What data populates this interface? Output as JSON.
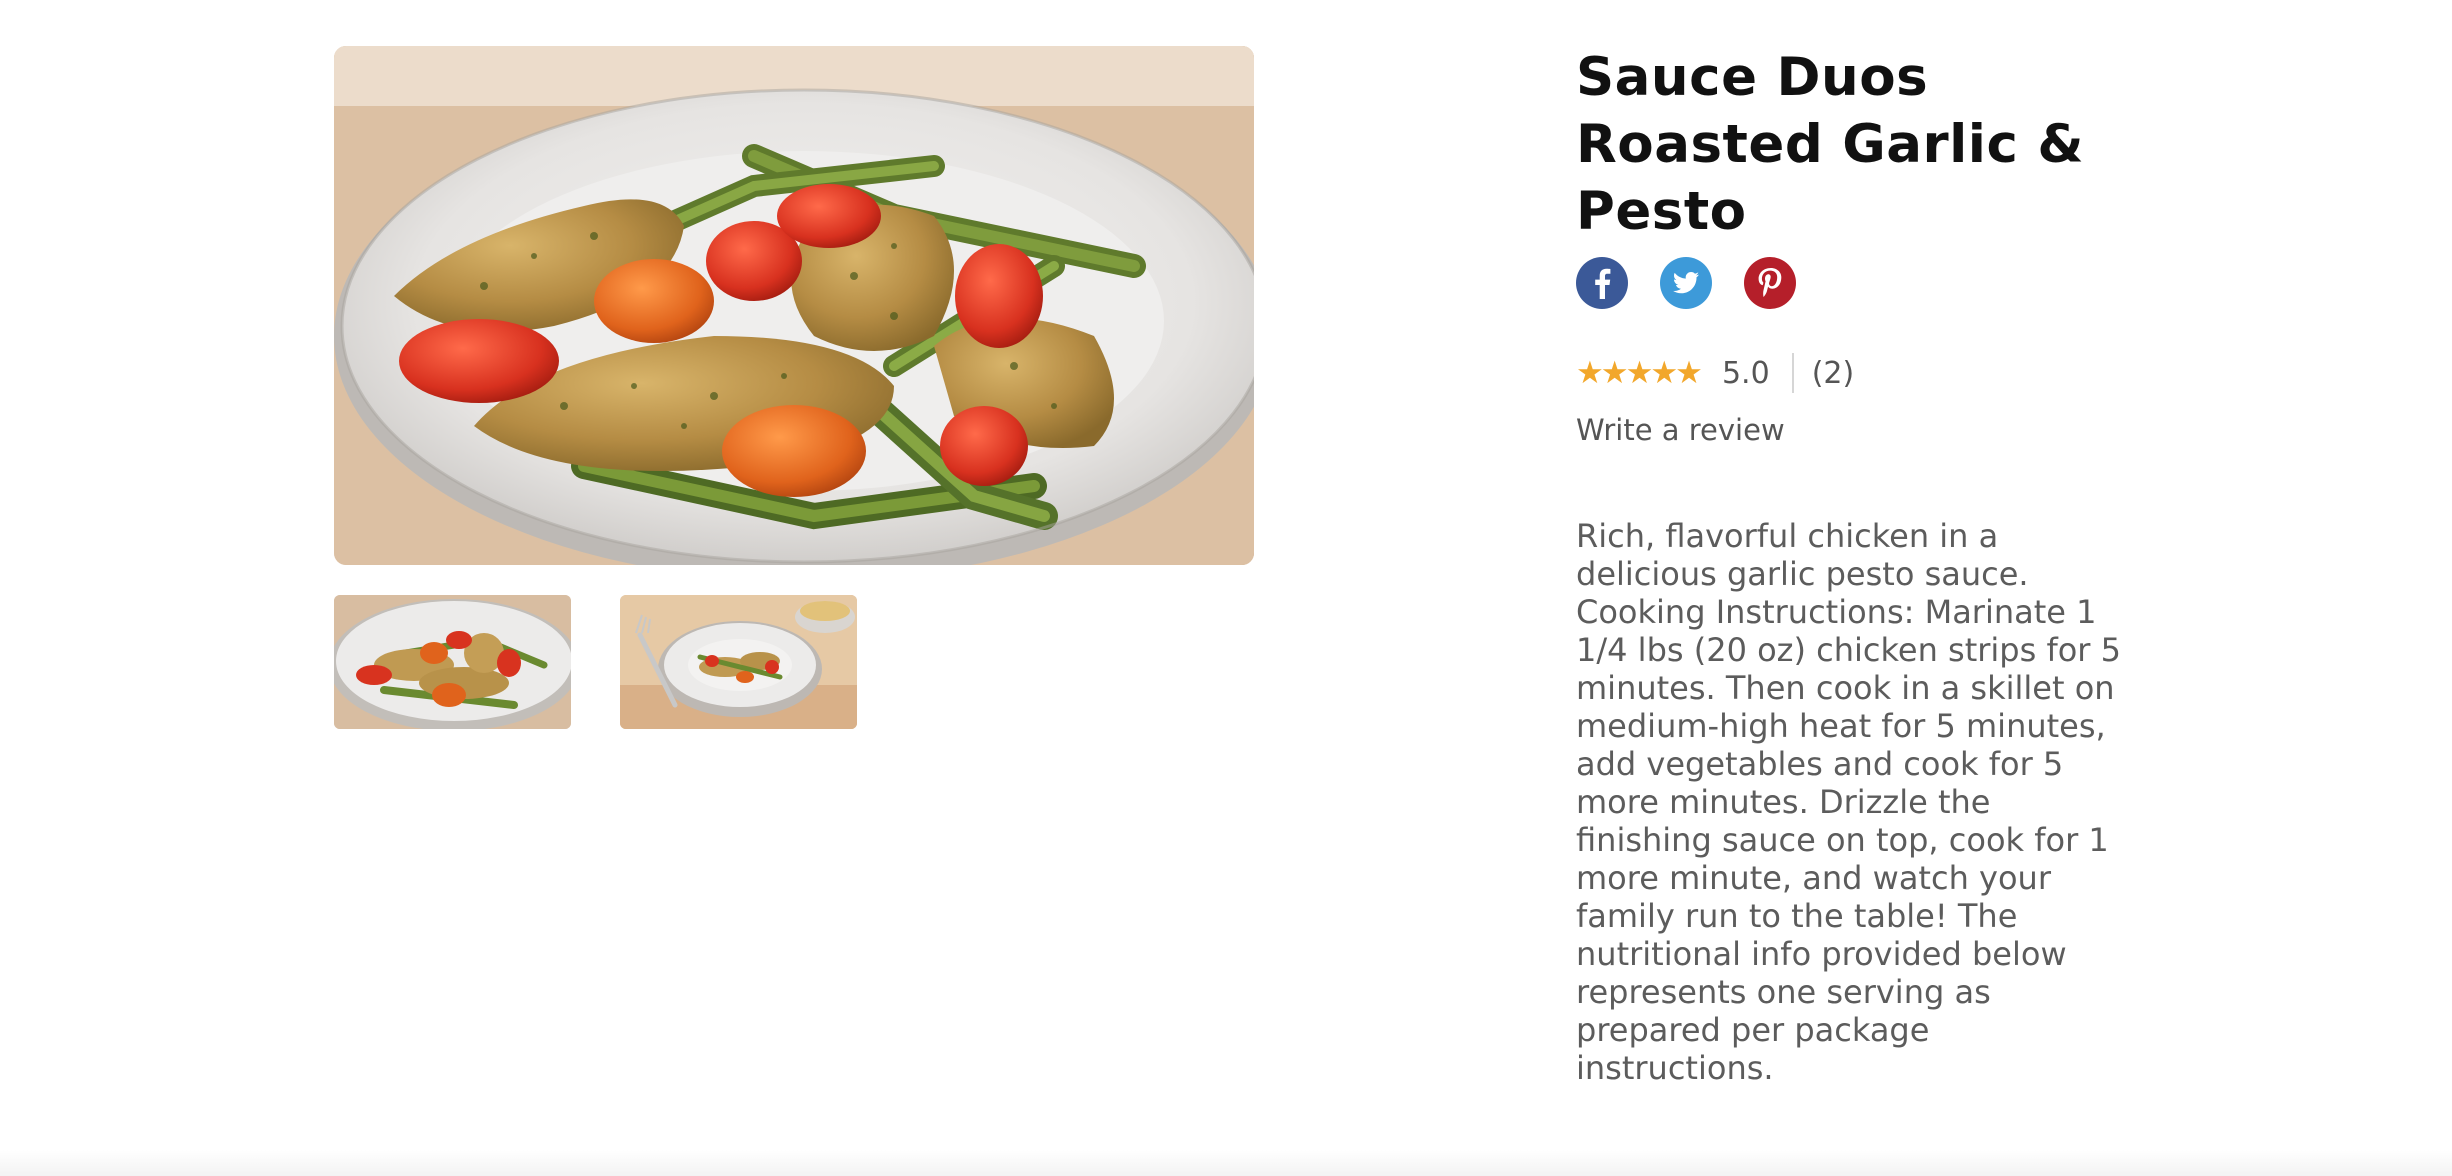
{
  "product": {
    "title": "Sauce Duos Roasted Garlic & Pesto",
    "description": "Rich, flavorful chicken in a delicious garlic pesto sauce. Cooking Instructions: Marinate 1 1/4 lbs (20 oz) chicken strips for 5 minutes. Then cook in a skillet on medium-high heat for 5 minutes, add vegetables and cook for 5 more minutes. Drizzle the finishing sauce on top, cook for 1 more minute, and watch your family run to the table! The nutritional info provided below represents one serving as prepared per package instructions."
  },
  "gallery": {
    "main_image": "plated chicken pesto dish",
    "thumbnails": [
      "plated dish close-up",
      "plated dish with fork and side bowl"
    ],
    "selected_index": 0
  },
  "share": {
    "icons": [
      "facebook-icon",
      "twitter-icon",
      "pinterest-icon"
    ],
    "colors": {
      "facebook": "#3b5998",
      "twitter": "#3d9ad9",
      "pinterest": "#b51f2a"
    }
  },
  "rating": {
    "stars": "★★★★★",
    "value": "5.0",
    "stars_filled": 5,
    "stars_total": 5,
    "count": "(2)",
    "star_color": "#f2a72b"
  },
  "review": {
    "write_label": "Write a review"
  }
}
